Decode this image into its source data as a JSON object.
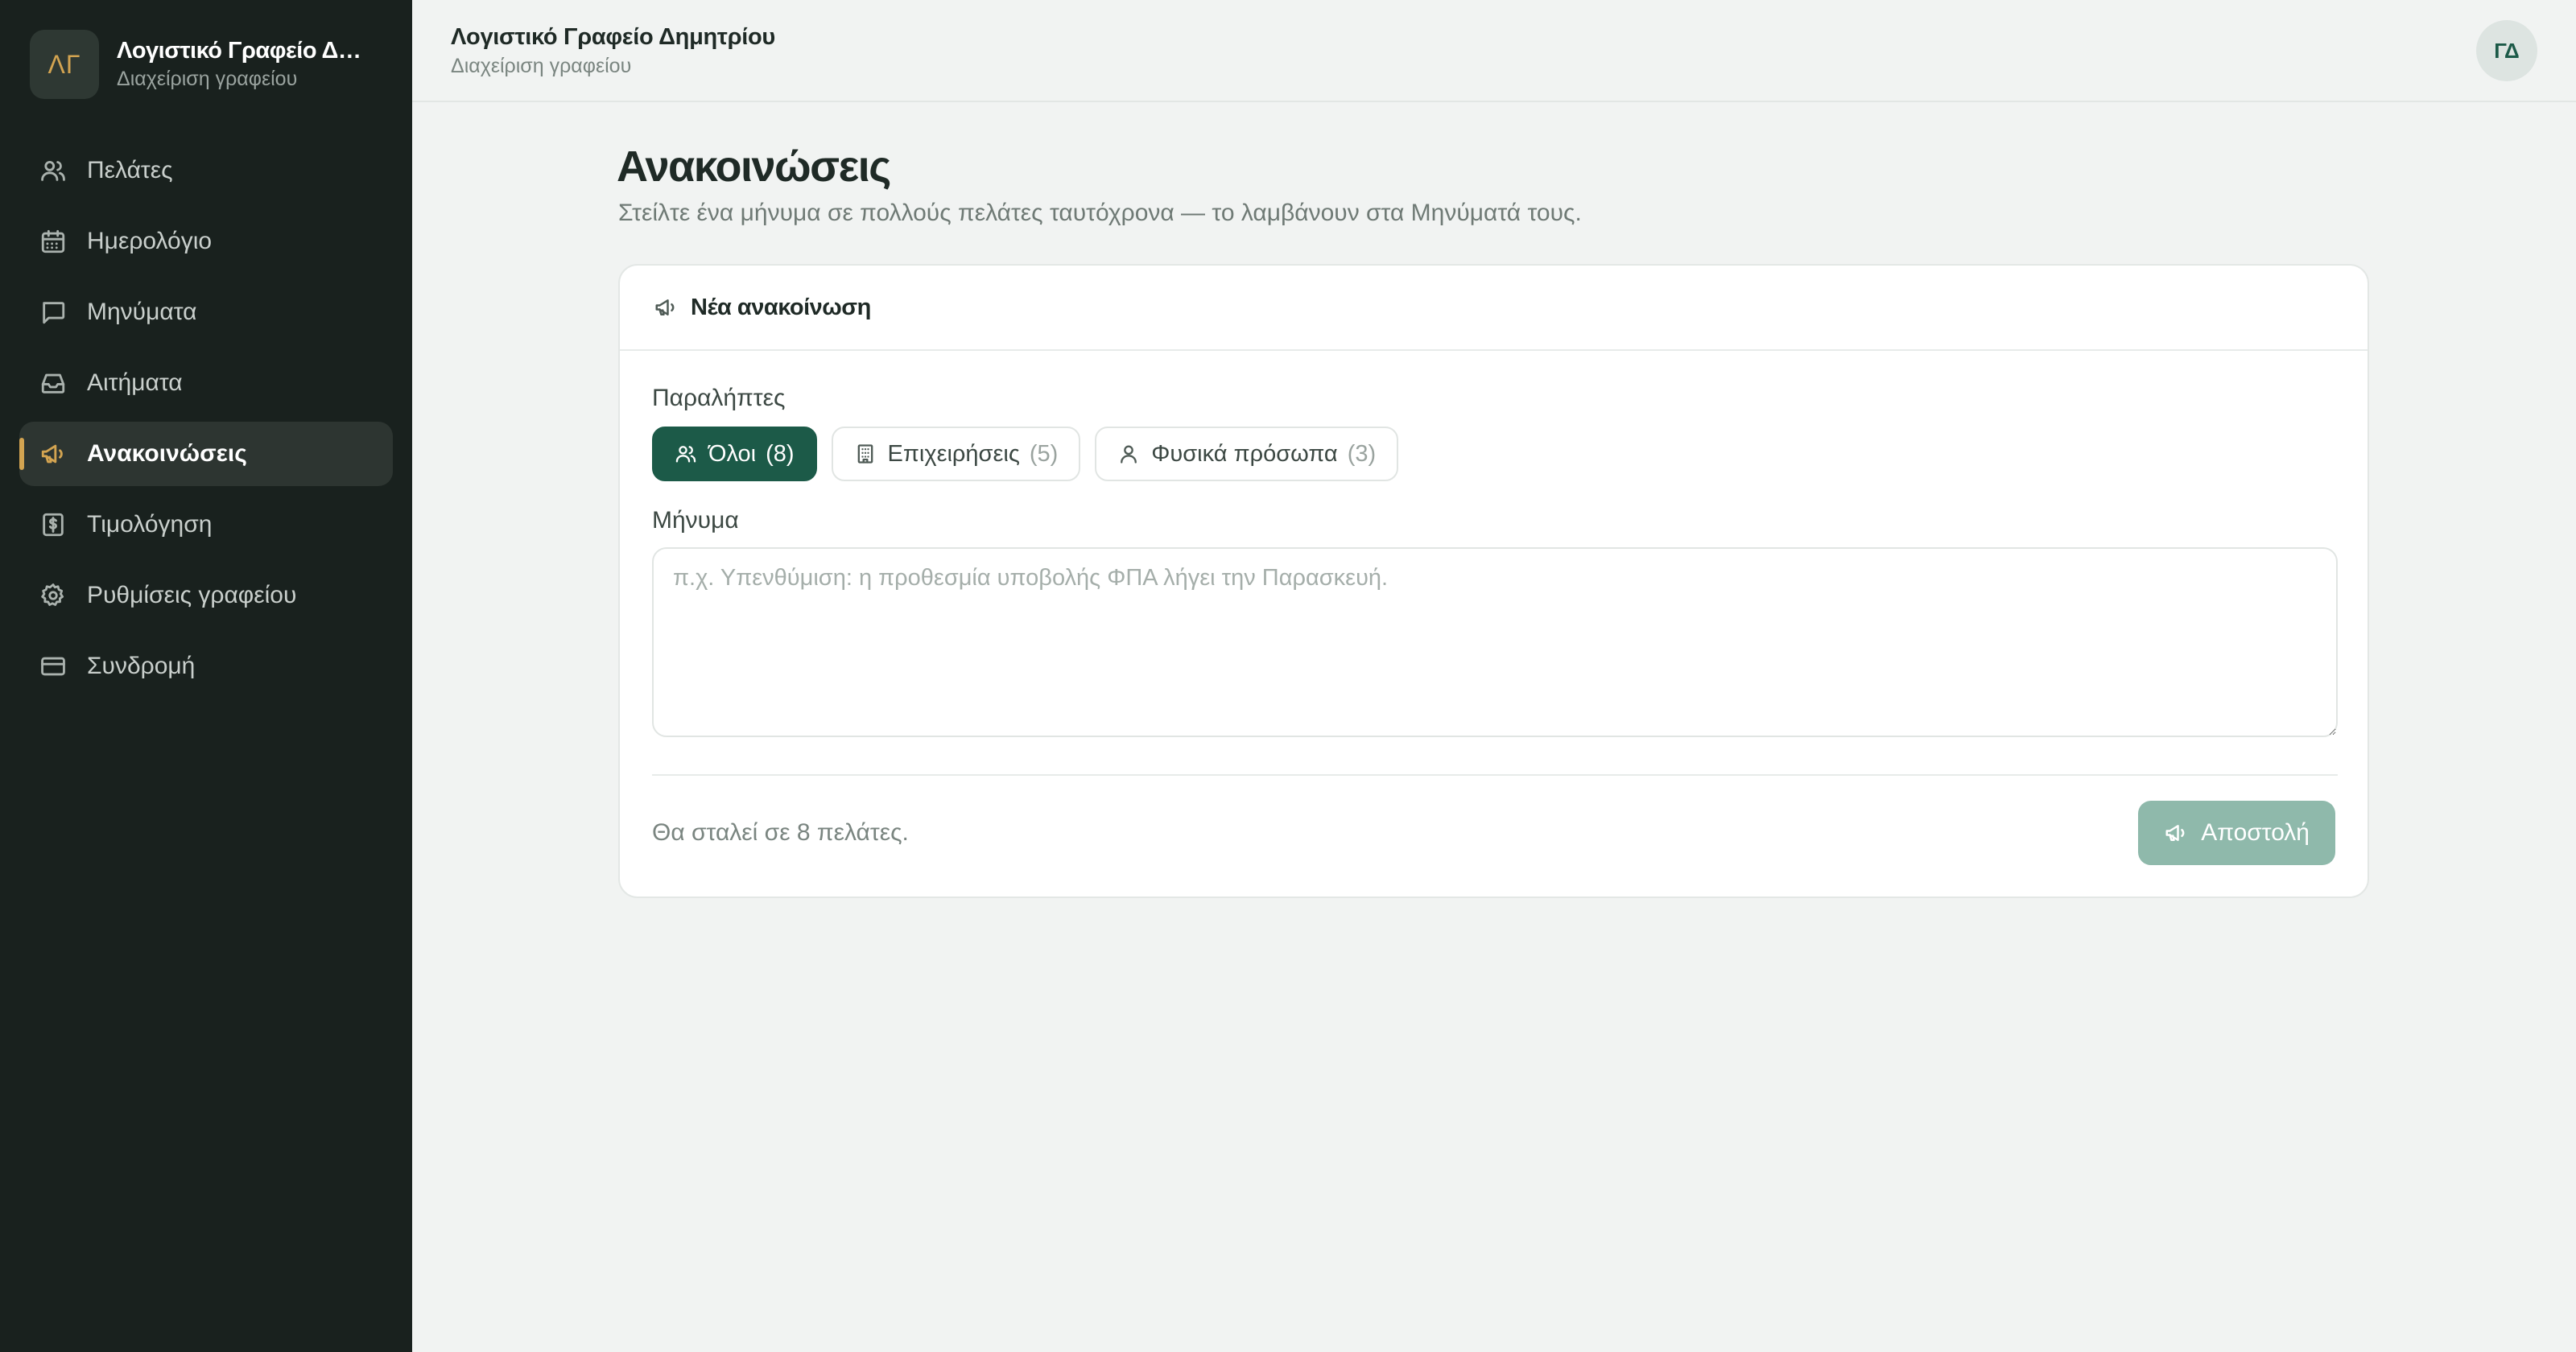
{
  "brand": {
    "initials": "ΛΓ",
    "title": "Λογιστικό Γραφείο Δημητρίου",
    "subtitle": "Διαχείριση γραφείου"
  },
  "sidebar": {
    "items": [
      {
        "label": "Πελάτες",
        "icon": "users-icon",
        "active": false
      },
      {
        "label": "Ημερολόγιο",
        "icon": "calendar-icon",
        "active": false
      },
      {
        "label": "Μηνύματα",
        "icon": "message-icon",
        "active": false
      },
      {
        "label": "Αιτήματα",
        "icon": "inbox-icon",
        "active": false
      },
      {
        "label": "Ανακοινώσεις",
        "icon": "megaphone-icon",
        "active": true
      },
      {
        "label": "Τιμολόγηση",
        "icon": "invoice-dollar-icon",
        "active": false
      },
      {
        "label": "Ρυθμίσεις γραφείου",
        "icon": "gear-icon",
        "active": false
      },
      {
        "label": "Συνδρομή",
        "icon": "credit-card-icon",
        "active": false
      }
    ]
  },
  "topbar": {
    "title": "Λογιστικό Γραφείο Δημητρίου",
    "subtitle": "Διαχείριση γραφείου",
    "avatar_initials": "ΓΔ"
  },
  "page": {
    "title": "Ανακοινώσεις",
    "subtitle": "Στείλτε ένα μήνυμα σε πολλούς πελάτες ταυτόχρονα — το λαμβάνουν στα Μηνύματά τους."
  },
  "card": {
    "title": "Νέα ανακοίνωση",
    "recipients_label": "Παραλήπτες",
    "recipients": [
      {
        "label": "Όλοι",
        "count": "(8)",
        "icon": "users-icon",
        "selected": true
      },
      {
        "label": "Επιχειρήσεις",
        "count": "(5)",
        "icon": "building-icon",
        "selected": false
      },
      {
        "label": "Φυσικά πρόσωπα",
        "count": "(3)",
        "icon": "user-icon",
        "selected": false
      }
    ],
    "message_label": "Μήνυμα",
    "message_value": "",
    "message_placeholder": "π.χ. Υπενθύμιση: η προθεσμία υποβολής ΦΠΑ λήγει την Παρασκευή.",
    "footer_note": "Θα σταλεί σε 8 πελάτες.",
    "send_label": "Αποστολή"
  },
  "colors": {
    "sidebar_bg": "#19211e",
    "accent_gold": "#d3a451",
    "primary_green": "#1c5a48",
    "send_disabled": "#8fb9ab",
    "page_bg": "#f1f3f2"
  }
}
